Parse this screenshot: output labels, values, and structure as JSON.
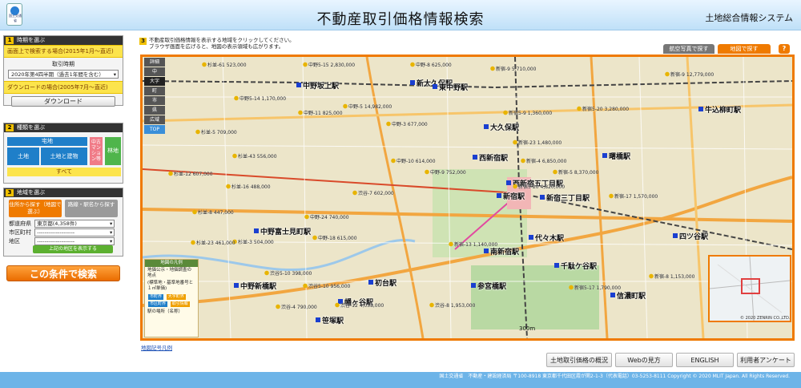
{
  "header": {
    "logo_text": "国土交通省",
    "title": "不動産取引価格情報検索",
    "system_name": "土地総合情報システム"
  },
  "step1": {
    "num": "1",
    "title": "時期を選ぶ",
    "screen_note": "画面上で検索する場合(2015年1月〜直近)",
    "period_label": "取引時期",
    "period_value": "2020年第4四半期（過去1年間を含む）",
    "download_note": "ダウンロードの場合(2005年7月〜直近)",
    "download_button": "ダウンロード"
  },
  "step2": {
    "num": "2",
    "title": "種類を選ぶ",
    "takuchi": "宅地",
    "tochi": "土地",
    "tochi_tatemono": "土地と建物",
    "condo": "中古マンション等",
    "rinchi": "林地",
    "all": "すべて"
  },
  "step3": {
    "num": "3",
    "title": "地域を選ぶ",
    "tab_place": "住所から探す（地図で選ぶ）",
    "tab_station": "路線・駅名から探す",
    "pref_label": "都道府県",
    "pref_value": "東京都(4,358件)",
    "city_label": "市区町村",
    "city_value": "--------------------",
    "district_label": "地区",
    "district_value": "--------------------",
    "show_area_button": "上記の地区を表示する"
  },
  "search_button": "この条件で検索",
  "map": {
    "instr_num": "3",
    "instruction_line1": "不動産取引価格情報を表示する地域をクリックしてください。",
    "instruction_line2": "ブラウザ画面を広げると、地図の表示領域も広がります。",
    "aerial_button": "航空写真で探す",
    "mapsearch_button": "地図で探す",
    "help_button": "?",
    "zoom_levels": [
      "詳細",
      "中",
      "大字",
      "町",
      "市",
      "県",
      "広域"
    ],
    "zoom_top": "TOP",
    "legend_title": "地図の凡例",
    "legend_line1": "地価公示・地価調査の地点",
    "legend_line2": "(標準地・基準地番号と１㎡単価)",
    "legend_chip1": "市町界",
    "legend_chip2": "大字町界",
    "legend_chip3": "市区町界",
    "legend_chip4": "取引情報",
    "legend_line3": "駅の場所（名称）",
    "scale_text": "300m",
    "minimap_copy": "© 2020 ZENRIN CO.,LTD.",
    "link_text": "地図記号凡例",
    "stations": [
      "新宿駅",
      "西新宿駅",
      "大久保駅",
      "新大久保駅",
      "代々木駅",
      "千駄ケ谷駅",
      "信濃町駅",
      "四ツ谷駅",
      "南新宿駅",
      "参宮橋駅",
      "笹塚駅",
      "初台駅",
      "幡ヶ谷駅",
      "中野坂上駅",
      "東中野駅",
      "中野新橋駅",
      "西新宿五丁目駅",
      "中野富士見町駅",
      "新宿三丁目駅",
      "曙橋駅",
      "牛込柳町駅"
    ],
    "price_labels": [
      "杉並-61 523,000",
      "中野5-15 2,830,000",
      "中野-8 625,000",
      "新宿-9 5,710,000",
      "新宿-9 12,779,000",
      "中野5-14 1,170,000",
      "中野-5 14,982,000",
      "新宿5-20 3,280,000",
      "中野-11 825,000",
      "新宿5-9 1,360,000",
      "杉並-5 709,000",
      "中野-3 677,000",
      "新宿-23 1,480,000",
      "杉並-43 556,000",
      "中野-10 614,000",
      "新宿-4 6,850,000",
      "杉並-12 607,000",
      "中野-9 752,000",
      "新宿-5 8,370,000",
      "杉並-16 488,000",
      "新宿5-20 4,820,000",
      "渋谷-7 602,000",
      "新宿-17 1,570,000",
      "杉並-8 447,000",
      "中野-24 740,000",
      "杉並-3 504,000",
      "中野-18 615,000",
      "新宿-13 1,140,000",
      "杉並-23 461,000",
      "渋谷5-10 398,000",
      "新宿-8 1,153,000",
      "渋谷5-10 956,000",
      "新宿5-17 1,790,000",
      "渋谷-12 4,038,000",
      "渋谷-8 1,953,000",
      "渋谷-4 790,000"
    ]
  },
  "bottom_buttons": {
    "overview": "土地取引価格の概況",
    "howto": "Webの見方",
    "english": "ENGLISH",
    "survey": "利用者アンケート"
  },
  "footer": "国土交通省　不動産・建設経済局 〒100-8918 東京都千代田区霞が関2-1-3（代表電話）03-5253-8111 Copyright © 2020 MLIT Japan. All Rights Reserved."
}
